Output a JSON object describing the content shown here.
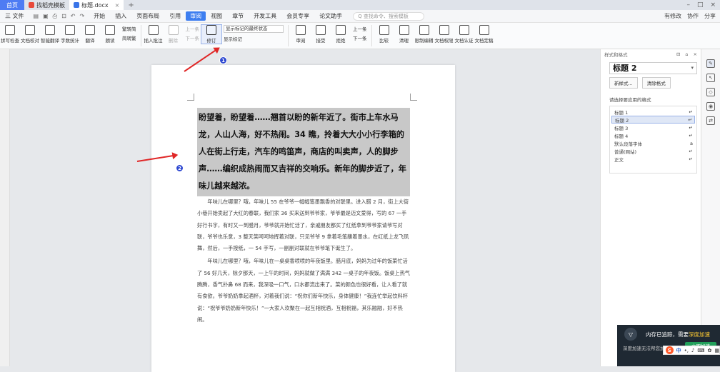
{
  "tabs": [
    {
      "label": "首页",
      "type": "home"
    },
    {
      "label": "找稻壳模板",
      "color": "#e8493a"
    },
    {
      "label": "标题.docx",
      "color": "#3a75e8",
      "active": true
    }
  ],
  "menubar": {
    "file": "三 文件",
    "items": [
      "开始",
      "插入",
      "页面布局",
      "引用",
      "审阅",
      "视图",
      "章节",
      "开发工具",
      "会员专享",
      "论文助手"
    ],
    "selected": "审阅",
    "search_placeholder": "Q 查找命令、搜索模板",
    "right": [
      "有修改",
      "协作",
      "分享"
    ]
  },
  "ribbon": {
    "group1": [
      "拼写检查",
      "文档校对",
      "智能翻译",
      "字数统计",
      "翻译",
      "朗读"
    ],
    "small1": [
      "繁转简",
      "简转繁"
    ],
    "group2": [
      "插入批注"
    ],
    "group2_small": [
      "删除"
    ],
    "nav": [
      "上一条",
      "下一条"
    ],
    "revise": "修订",
    "select1": "显示标记的最终状态",
    "select2": "显示标记",
    "group3": [
      "审阅",
      "接受",
      "拒绝"
    ],
    "nav2": [
      "上一条",
      "下一条"
    ],
    "group4": [
      "比较",
      "清理",
      "限制编辑",
      "文档权限",
      "文档认证",
      "文档定稿"
    ]
  },
  "document": {
    "heading": "盼望着，盼望着……翘首以盼的新年近了。街市上车水马龙，人山人海，好不热闹。34 瞧，拎着大大小小行李箱的人在街上行走，汽车的鸣笛声，商店的叫卖声，人的脚步声……编织成热闹而又吉祥的交响乐。新年的脚步近了，年味儿越来越浓。",
    "para1": "年味儿在哪里？哦，年味儿 55 在爷爷一幅幅笔墨飘香的对联里。进入腊 2 月，街上大街小巷开始卖起了大红的春联，我们家 36 买来送到爷爷家，爷爷最是迈文爱得，写的 67 一手好行书字，有时又一到腊月，爷爷就开始忙活了，亲戚朋友都买了红纸拿到爷爷家请爷写对联，爷爷也乐意，3 整天笑呵呵地挥着对联，只见爷爷 9 拿着毛笔蘸着墨水，在红纸上龙飞凤舞，然后，一手按纸，一 54 手写，一副副对联就在爷爷笔下诞生了。",
    "para2": "年味儿在哪里？哦，年味儿在一桌桌香喷喷的年夜饭里。腊月底，妈妈为过年的饭菜忙活了 56 好几天，除夕那天，一上午的时间，妈妈就做了满满 342 一桌子的年夜饭。饭桌上热气腾腾，香气扑鼻 68 而来，我深吸一口气，口水都流出来了。菜的颜色也很好看，让人看了就有食欲。爷爷奶奶拿起酒杯，对着我们说：“祝你们新年快乐，身体健康！”我连忙举起饮料杯说：“祝爷爷奶奶新年快乐！”一大家人欢聚在一起互相祝酒，互相祝福，其乐融融，好不热闹。"
  },
  "panel": {
    "title": "样式和格式",
    "current_style": "标题 2",
    "new_style": "新样式...",
    "clear_format": "清除格式",
    "list_label": "请选择要应用的格式",
    "styles": [
      "标题 1",
      "标题 2",
      "标题 3",
      "标题 4",
      "默认段落字体",
      "普通(网站)",
      "正文"
    ],
    "selected_style": "标题 2"
  },
  "annotations": [
    "1",
    "2"
  ],
  "popup": {
    "line1_a": "内存已追踪，需要",
    "line1_b": "深度加速",
    "line2": "深度加速无法帮您加速",
    "button": "立即加速"
  },
  "ime": {
    "logo": "S",
    "lang": "中"
  }
}
